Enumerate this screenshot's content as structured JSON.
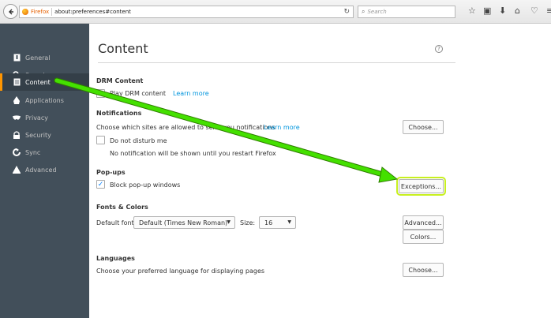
{
  "toolbar": {
    "brand": "Firefox",
    "url": "about:preferences#content",
    "search_placeholder": "Search"
  },
  "sidebar": {
    "items": [
      {
        "label": "General",
        "icon": "general-icon"
      },
      {
        "label": "Search",
        "icon": "search-icon"
      },
      {
        "label": "Content",
        "icon": "content-icon",
        "selected": true
      },
      {
        "label": "Applications",
        "icon": "applications-icon"
      },
      {
        "label": "Privacy",
        "icon": "privacy-icon"
      },
      {
        "label": "Security",
        "icon": "security-icon"
      },
      {
        "label": "Sync",
        "icon": "sync-icon"
      },
      {
        "label": "Advanced",
        "icon": "advanced-icon"
      }
    ]
  },
  "main": {
    "title": "Content",
    "drm": {
      "title": "DRM Content",
      "checkbox_label": "Play DRM content",
      "learn_more": "Learn more",
      "checked": true
    },
    "notifications": {
      "title": "Notifications",
      "description": "Choose which sites are allowed to send you notifications",
      "learn_more": "Learn more",
      "choose_button": "Choose...",
      "dnd_label": "Do not disturb me",
      "dnd_checked": false,
      "dnd_note": "No notification will be shown until you restart Firefox"
    },
    "popups": {
      "title": "Pop-ups",
      "checkbox_label": "Block pop-up windows",
      "checked": true,
      "exceptions_button": "Exceptions..."
    },
    "fonts": {
      "title": "Fonts & Colors",
      "default_font_label": "Default font:",
      "default_font_value": "Default (Times New Roman)",
      "size_label": "Size:",
      "size_value": "16",
      "advanced_button": "Advanced...",
      "colors_button": "Colors..."
    },
    "languages": {
      "title": "Languages",
      "description": "Choose your preferred language for displaying pages",
      "choose_button": "Choose..."
    }
  },
  "colors": {
    "sidebar_bg": "#424f5a",
    "selected_accent": "#ff9500",
    "link": "#0095dd",
    "arrow": "#44e000",
    "highlight": "#c8f020"
  }
}
